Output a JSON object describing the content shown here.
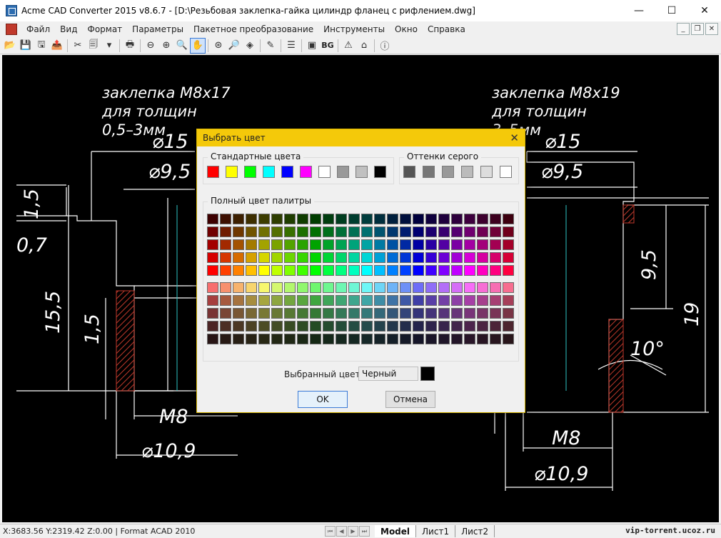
{
  "window": {
    "title": "Acme CAD Converter 2015 v8.6.7 - [D:\\Резьбовая заклепка-гайка цилиндр фланец с рифлением.dwg]",
    "minimize": "—",
    "maximize": "☐",
    "close": "✕"
  },
  "menu": {
    "items": [
      {
        "label": "Файл"
      },
      {
        "label": "Вид"
      },
      {
        "label": "Формат"
      },
      {
        "label": "Параметры"
      },
      {
        "label": "Пакетное преобразование"
      },
      {
        "label": "Инструменты"
      },
      {
        "label": "Окно"
      },
      {
        "label": "Справка"
      }
    ],
    "mdi_min": "_",
    "mdi_restore": "❐",
    "mdi_close": "✕"
  },
  "toolbar": {
    "buttons": [
      {
        "icon": "open-folder-icon",
        "glyph": "📂"
      },
      {
        "icon": "save-icon",
        "glyph": "💾"
      },
      {
        "icon": "save-as-icon",
        "glyph": "🖫"
      },
      {
        "icon": "export-icon",
        "glyph": "📤"
      },
      {
        "icon": "separator"
      },
      {
        "icon": "convert-icon",
        "glyph": "✂"
      },
      {
        "icon": "batch-icon",
        "glyph": "🗐"
      },
      {
        "icon": "dropdown-arrow-icon",
        "glyph": "▾"
      },
      {
        "icon": "separator"
      },
      {
        "icon": "print-icon",
        "glyph": "🖶"
      },
      {
        "icon": "separator"
      },
      {
        "icon": "zoom-out-icon",
        "glyph": "⊖"
      },
      {
        "icon": "zoom-in-icon",
        "glyph": "⊕"
      },
      {
        "icon": "zoom-window-icon",
        "glyph": "🔍"
      },
      {
        "icon": "pan-hand-icon",
        "glyph": "✋",
        "active": true
      },
      {
        "icon": "separator"
      },
      {
        "icon": "zoom-extents-icon",
        "glyph": "⊛"
      },
      {
        "icon": "zoom-realtime-icon",
        "glyph": "🔎"
      },
      {
        "icon": "layers-icon",
        "glyph": "◈"
      },
      {
        "icon": "separator"
      },
      {
        "icon": "measure-icon",
        "glyph": "✎"
      },
      {
        "icon": "separator"
      },
      {
        "icon": "layouts-icon",
        "glyph": "☰"
      },
      {
        "icon": "separator"
      },
      {
        "icon": "properties-icon",
        "glyph": "▣"
      },
      {
        "icon": "background-text",
        "text": "BG"
      },
      {
        "icon": "separator"
      },
      {
        "icon": "warning-icon",
        "glyph": "⚠"
      },
      {
        "icon": "home-icon",
        "glyph": "⌂"
      },
      {
        "icon": "separator"
      },
      {
        "icon": "info-icon",
        "glyph": "ⓘ"
      }
    ]
  },
  "drawing": {
    "left_title": [
      "заклепка М8х17",
      "для толщин",
      "0,5–3мм"
    ],
    "right_title": [
      "заклепка М8х19",
      "для толщин",
      "3–5мм"
    ],
    "dims_left": {
      "d15": "⌀15",
      "d95": "⌀9,5",
      "h15a": "1,5",
      "h07": "0,7",
      "h155": "15,5",
      "h15b": "1,5",
      "m8": "М8",
      "d109": "⌀10,9"
    },
    "dims_right": {
      "d15": "⌀15",
      "d95": "⌀9,5",
      "h95": "9,5",
      "h19": "19",
      "angle": "10°",
      "m8": "М8",
      "d109": "⌀10,9"
    }
  },
  "status": {
    "coords": "X:3683.56 Y:2319.42 Z:0.00 | Format ACAD 2010",
    "tabs": [
      {
        "label": "Model",
        "active": true
      },
      {
        "label": "Лист1"
      },
      {
        "label": "Лист2"
      }
    ],
    "watermark": "vip-torrent.ucoz.ru"
  },
  "dialog": {
    "title": "Выбрать цвет",
    "close": "✕",
    "standard_label": "Стандартные цвета",
    "standard_colors": [
      "#ff0000",
      "#ffff00",
      "#00ff00",
      "#00ffff",
      "#0000ff",
      "#ff00ff",
      "#ffffff",
      "#999999",
      "#c0c0c0",
      "#000000"
    ],
    "gray_label": "Оттенки серого",
    "gray_colors": [
      "#555555",
      "#777777",
      "#999999",
      "#bbbbbb",
      "#dddddd",
      "#ffffff"
    ],
    "palette_label": "Полный цвет палитры",
    "selected_label": "Выбранный цвет",
    "selected_name": "Черный",
    "selected_color": "#000000",
    "ok": "OK",
    "cancel": "Отмена"
  }
}
